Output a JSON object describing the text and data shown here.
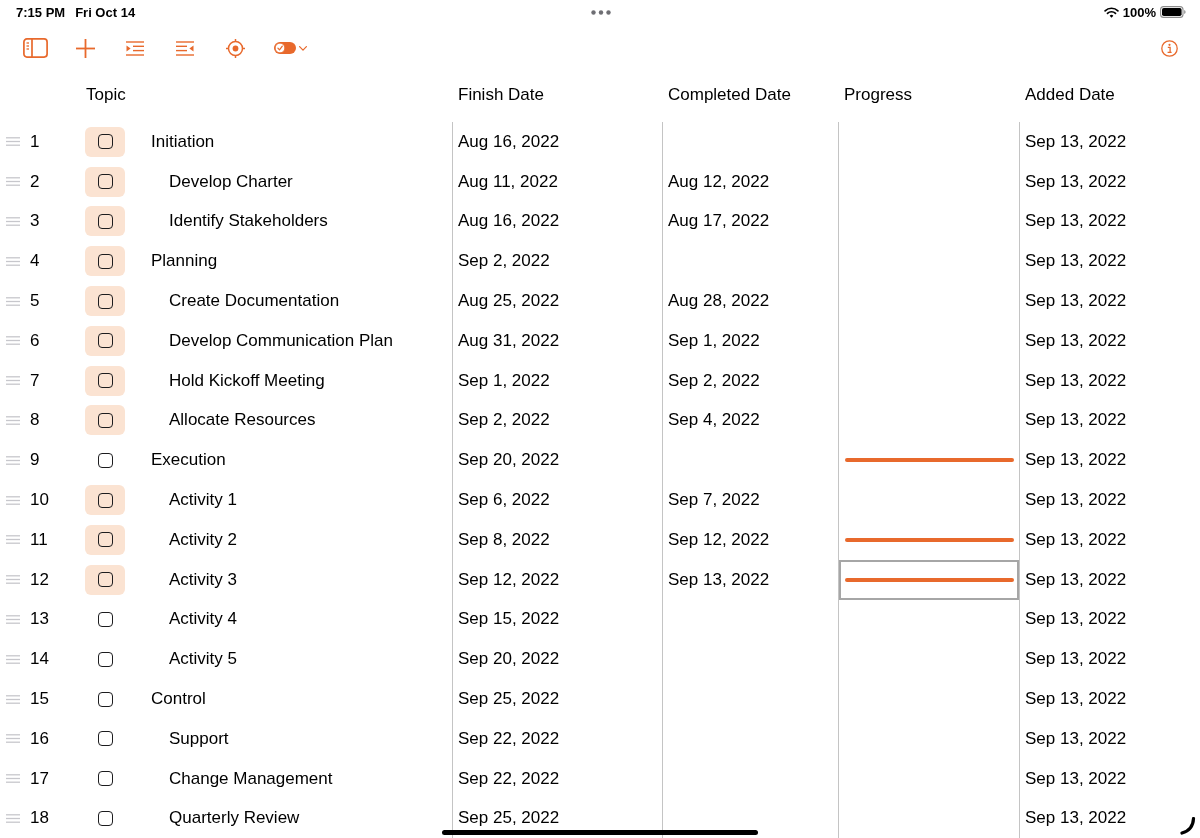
{
  "status_bar": {
    "time": "7:15 PM",
    "date": "Fri Oct 14",
    "battery": "100%"
  },
  "table": {
    "columns": [
      "Topic",
      "Finish Date",
      "Completed Date",
      "Progress",
      "Added Date"
    ],
    "rows": [
      {
        "number": "1",
        "checked": false,
        "selected": true,
        "topic": "Initiation",
        "finish_date": "Aug 16, 2022",
        "added_date": "Sep 13, 2022",
        "children": [
          {
            "number": "2",
            "checked": false,
            "selected": true,
            "topic": "Develop Charter",
            "finish_date": "Aug 11, 2022",
            "completed_date": "Aug 12, 2022",
            "added_date": "Sep 13, 2022"
          },
          {
            "number": "3",
            "checked": false,
            "selected": true,
            "topic": "Identify Stakeholders",
            "finish_date": "Aug 16, 2022",
            "completed_date": "Aug 17, 2022",
            "added_date": "Sep 13, 2022"
          }
        ]
      },
      {
        "number": "4",
        "checked": false,
        "selected": true,
        "topic": "Planning",
        "finish_date": "Sep 2, 2022",
        "added_date": "Sep 13, 2022",
        "children": [
          {
            "number": "5",
            "checked": false,
            "selected": true,
            "topic": "Create Documentation",
            "finish_date": "Aug 25, 2022",
            "completed_date": "Aug 28, 2022",
            "added_date": "Sep 13, 2022"
          },
          {
            "number": "6",
            "checked": false,
            "selected": true,
            "topic": "Develop Communication Plan",
            "finish_date": "Aug 31, 2022",
            "completed_date": "Sep 1, 2022",
            "added_date": "Sep 13, 2022"
          },
          {
            "number": "7",
            "checked": false,
            "selected": true,
            "topic": "Hold Kickoff Meeting",
            "finish_date": "Sep 1, 2022",
            "completed_date": "Sep 2, 2022",
            "added_date": "Sep 13, 2022"
          },
          {
            "number": "8",
            "checked": false,
            "selected": true,
            "topic": "Allocate Resources",
            "finish_date": "Sep 2, 2022",
            "completed_date": "Sep 4, 2022",
            "added_date": "Sep 13, 2022"
          }
        ]
      },
      {
        "number": "9",
        "checked": false,
        "selected": false,
        "topic": "Execution",
        "finish_date": "Sep 20, 2022",
        "progress": {
          "level": 1,
          "focused": false
        },
        "added_date": "Sep 13, 2022",
        "children": [
          {
            "number": "10",
            "checked": false,
            "selected": true,
            "topic": "Activity 1",
            "finish_date": "Sep 6, 2022",
            "completed_date": "Sep 7, 2022",
            "added_date": "Sep 13, 2022"
          },
          {
            "number": "11",
            "checked": false,
            "selected": true,
            "topic": "Activity 2",
            "finish_date": "Sep 8, 2022",
            "completed_date": "Sep 12, 2022",
            "progress": {
              "level": 1,
              "focused": false
            },
            "added_date": "Sep 13, 2022"
          },
          {
            "number": "12",
            "checked": false,
            "selected": true,
            "topic": "Activity 3",
            "finish_date": "Sep 12, 2022",
            "completed_date": "Sep 13, 2022",
            "progress": {
              "level": 1,
              "focused": true
            },
            "added_date": "Sep 13, 2022"
          },
          {
            "number": "13",
            "checked": false,
            "selected": false,
            "topic": "Activity 4",
            "finish_date": "Sep 15, 2022",
            "added_date": "Sep 13, 2022"
          },
          {
            "number": "14",
            "checked": false,
            "selected": false,
            "topic": "Activity 5",
            "finish_date": "Sep 20, 2022",
            "added_date": "Sep 13, 2022"
          }
        ]
      },
      {
        "number": "15",
        "checked": false,
        "selected": false,
        "topic": "Control",
        "finish_date": "Sep 25, 2022",
        "added_date": "Sep 13, 2022",
        "children": [
          {
            "number": "16",
            "checked": false,
            "selected": false,
            "topic": "Support",
            "finish_date": "Sep 22, 2022",
            "added_date": "Sep 13, 2022"
          },
          {
            "number": "17",
            "checked": false,
            "selected": false,
            "topic": "Change Management",
            "finish_date": "Sep 22, 2022",
            "added_date": "Sep 13, 2022"
          },
          {
            "number": "18",
            "checked": false,
            "selected": false,
            "topic": "Quarterly Review",
            "finish_date": "Sep 25, 2022",
            "added_date": "Sep 13, 2022"
          }
        ]
      }
    ]
  }
}
